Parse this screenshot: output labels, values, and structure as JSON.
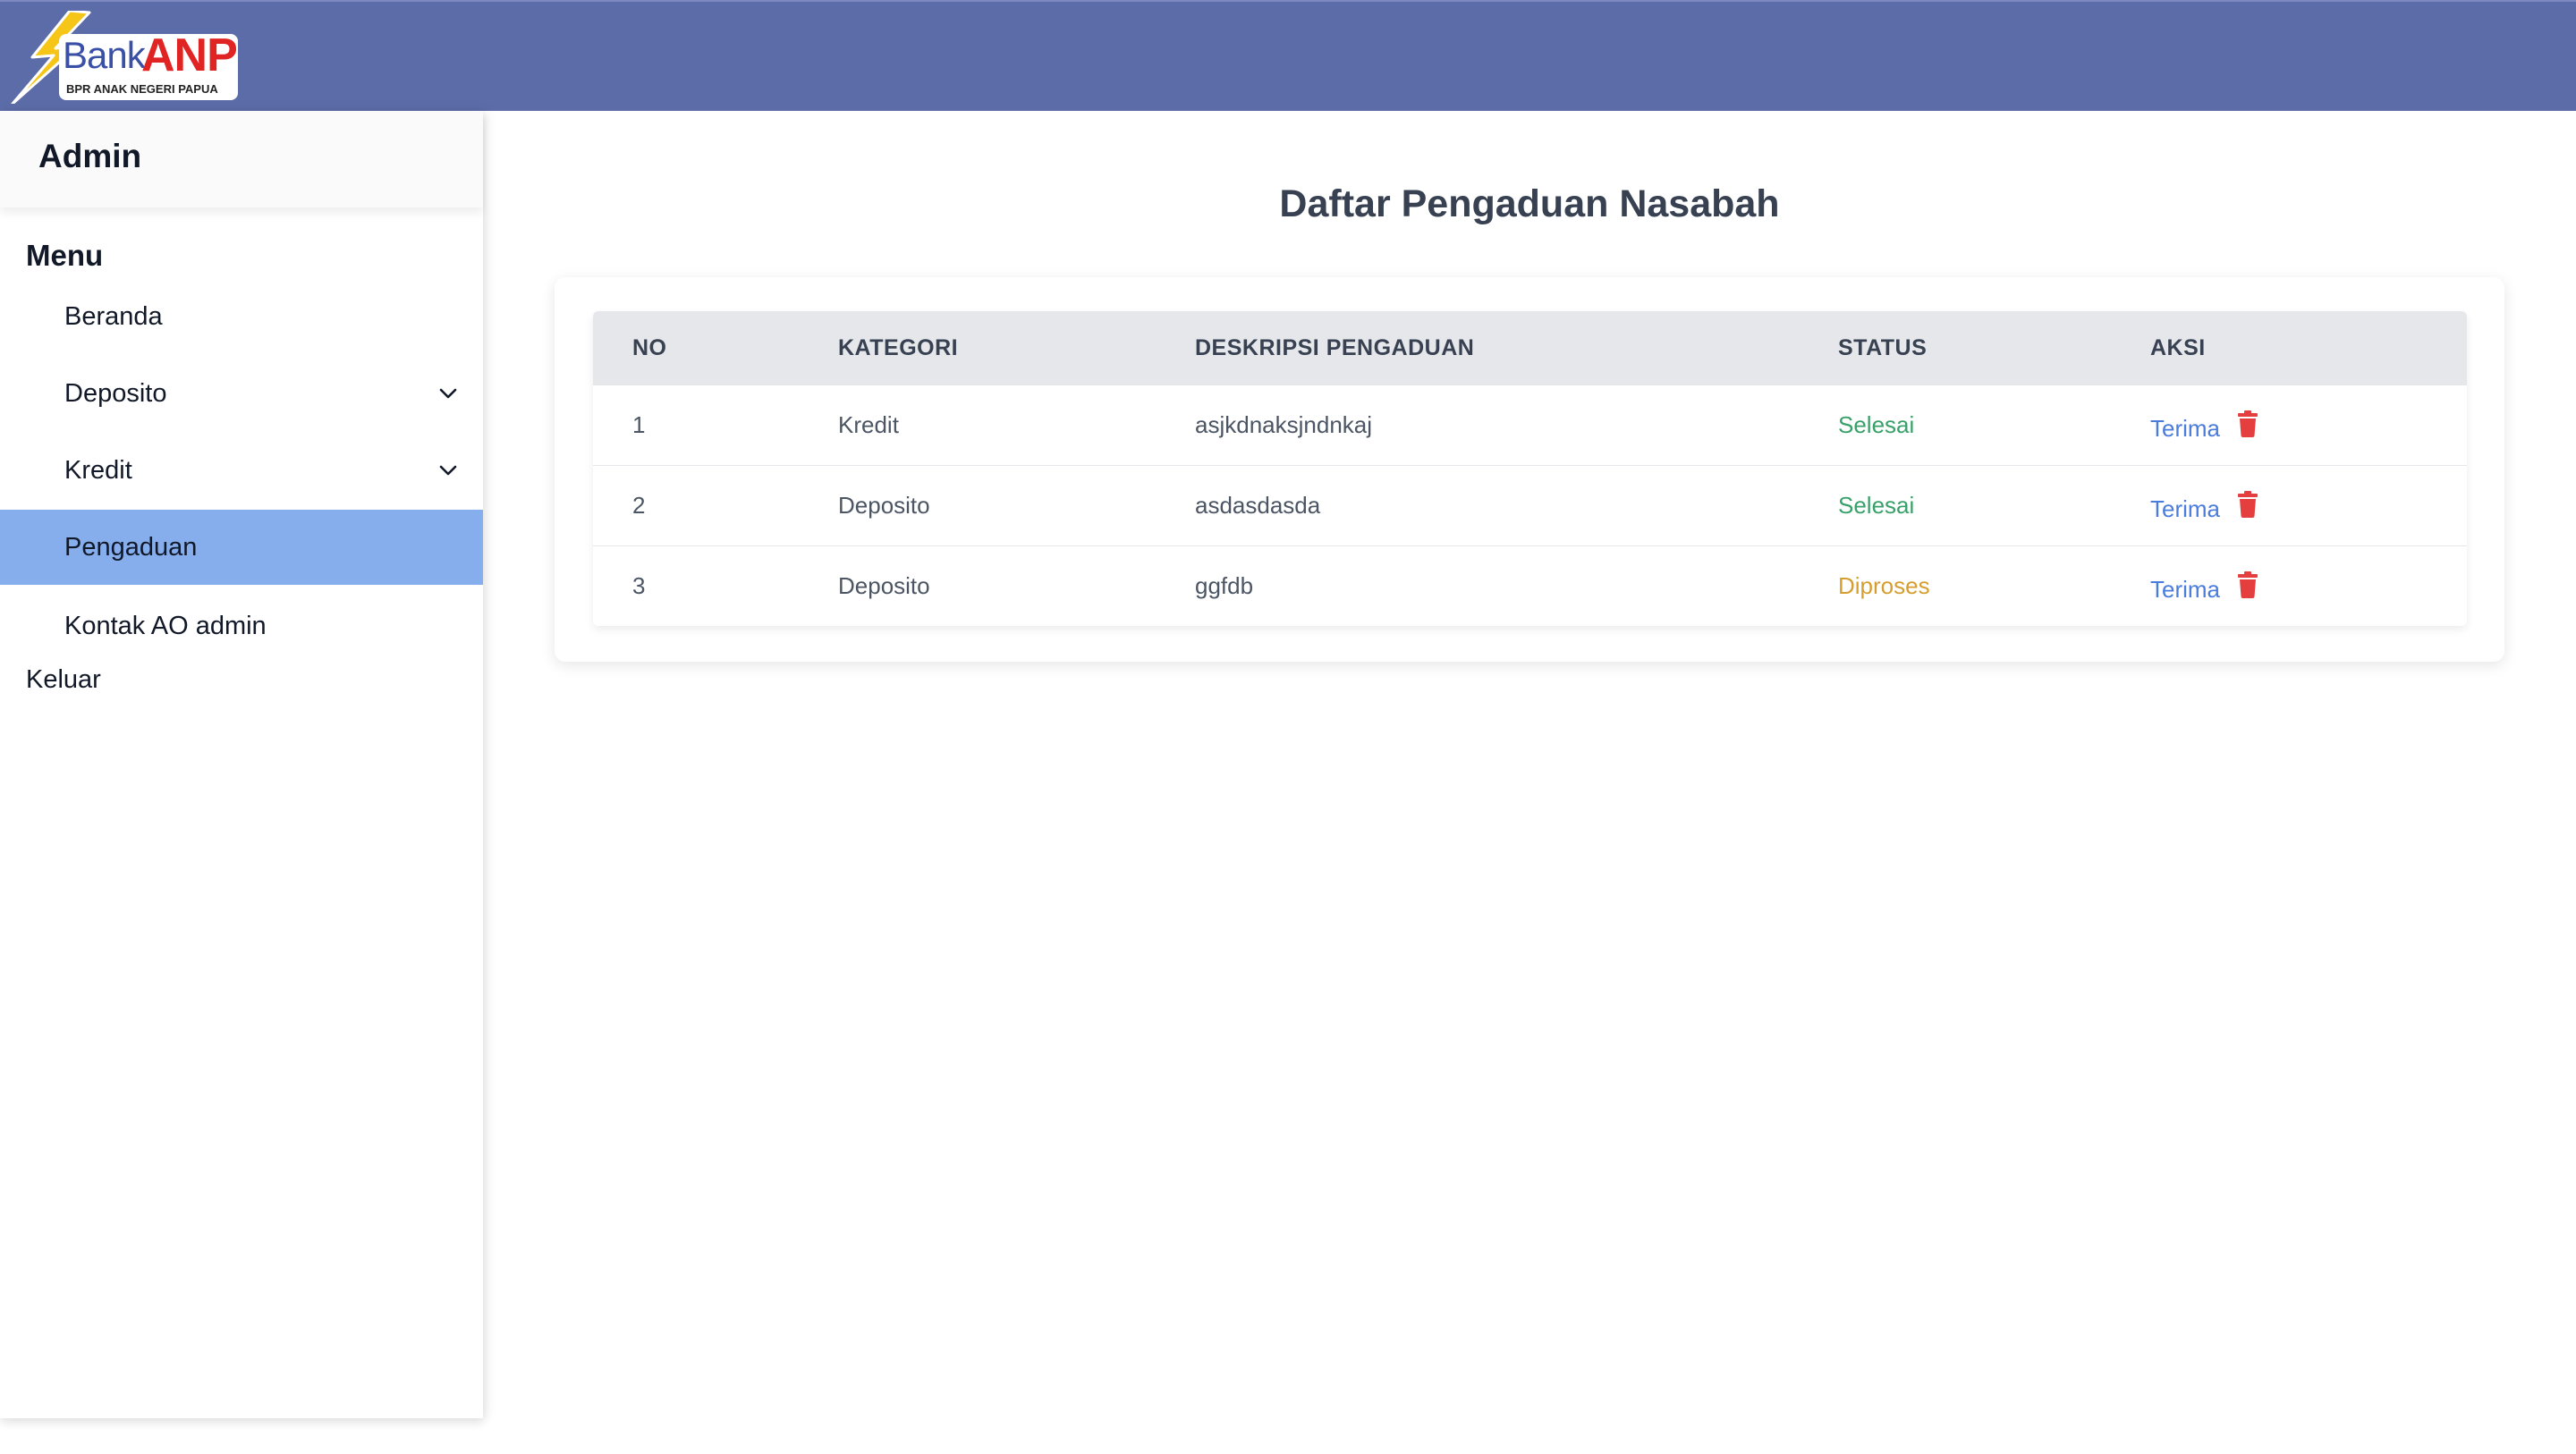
{
  "brand": {
    "logo_bank": "Bank",
    "logo_anp": "ANP",
    "logo_subtitle": "BPR ANAK NEGERI PAPUA",
    "header_color": "#5b6ca8"
  },
  "sidebar": {
    "title": "Admin",
    "menu_heading": "Menu",
    "items": [
      {
        "label": "Beranda",
        "has_dropdown": false,
        "active": false
      },
      {
        "label": "Deposito",
        "has_dropdown": true,
        "active": false
      },
      {
        "label": "Kredit",
        "has_dropdown": true,
        "active": false
      },
      {
        "label": "Pengaduan",
        "has_dropdown": false,
        "active": true
      },
      {
        "label": "Kontak AO admin",
        "has_dropdown": false,
        "active": false
      }
    ],
    "logout_label": "Keluar",
    "active_color": "#86aeec"
  },
  "main": {
    "title": "Daftar Pengaduan Nasabah",
    "table": {
      "headers": [
        "NO",
        "KATEGORI",
        "DESKRIPSI PENGADUAN",
        "STATUS",
        "AKSI"
      ],
      "rows": [
        {
          "no": "1",
          "kategori": "Kredit",
          "deskripsi": "asjkdnaksjndnkaj",
          "status": "Selesai",
          "action": "Terima"
        },
        {
          "no": "2",
          "kategori": "Deposito",
          "deskripsi": "asdasdasda",
          "status": "Selesai",
          "action": "Terima"
        },
        {
          "no": "3",
          "kategori": "Deposito",
          "deskripsi": "ggfdb",
          "status": "Diproses",
          "action": "Terima"
        }
      ]
    },
    "status_colors": {
      "Selesai": "#38a169",
      "Diproses": "#d69e2e"
    },
    "icons": {
      "delete": "trash-icon",
      "dropdown": "chevron-down-icon"
    }
  }
}
